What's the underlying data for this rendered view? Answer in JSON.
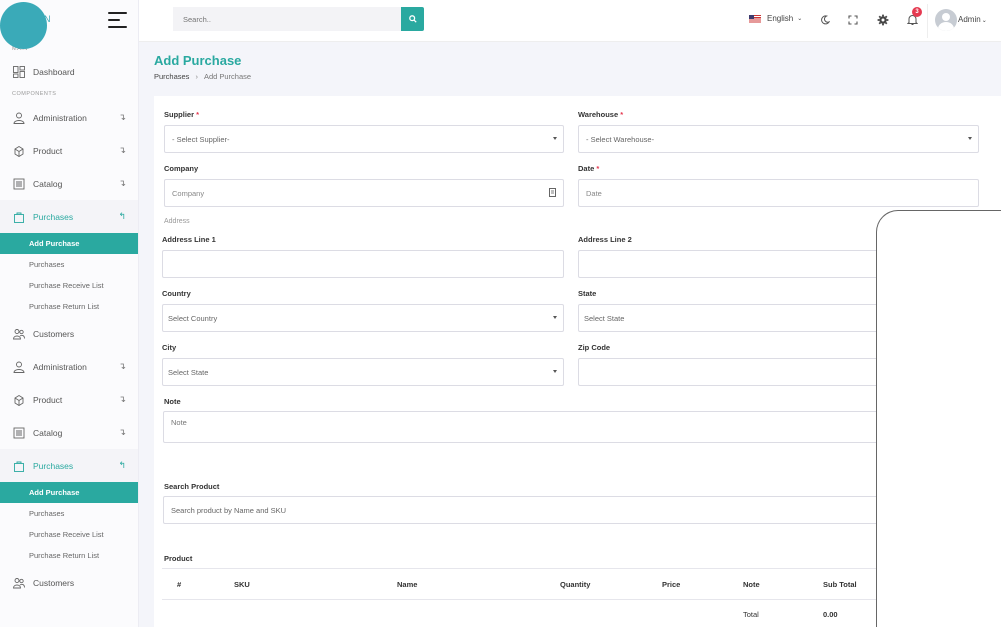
{
  "brand": {
    "logo_text": "N"
  },
  "sidebar": {
    "main_label": "MAIN",
    "components_label": "COMPONENTS",
    "dashboard": "Dashboard",
    "groups": [
      {
        "items": [
          {
            "label": "Administration"
          },
          {
            "label": "Product"
          },
          {
            "label": "Catalog"
          }
        ],
        "purchases": {
          "label": "Purchases",
          "subitems": [
            "Add Purchase",
            "Purchases",
            "Purchase Receive List",
            "Purchase Return List"
          ]
        },
        "customers": "Customers"
      },
      {
        "items": [
          {
            "label": "Administration"
          },
          {
            "label": "Product"
          },
          {
            "label": "Catalog"
          }
        ],
        "purchases": {
          "label": "Purchases",
          "subitems": [
            "Add Purchase",
            "Purchases",
            "Purchase Receive List",
            "Purchase Return List"
          ]
        },
        "customers": "Customers"
      }
    ]
  },
  "topbar": {
    "search_placeholder": "Search..",
    "language": "English",
    "notification_count": "3",
    "user": "Admin"
  },
  "page": {
    "title": "Add Purchase",
    "breadcrumb": [
      "Purchases",
      "Add Purchase"
    ]
  },
  "form": {
    "supplier_label": "Supplier",
    "supplier_value": "- Select Supplier-",
    "warehouse_label": "Warehouse",
    "warehouse_value": "- Select Warehouse-",
    "company_label": "Company",
    "company_placeholder": "Company",
    "date_label": "Date",
    "date_placeholder": "Date",
    "address_section": "Address",
    "address1_label": "Address Line 1",
    "address2_label": "Address Line 2",
    "country_label": "Country",
    "country_value": "Select Country",
    "state_label": "State",
    "state_value": "Select State",
    "city_label": "City",
    "city_value": "Select State",
    "zip_label": "Zip Code",
    "note_label": "Note",
    "note_placeholder": "Note",
    "search_product_label": "Search Product",
    "search_product_placeholder": "Search product by Name and SKU",
    "required_mark": "*"
  },
  "product_table": {
    "title": "Product",
    "columns": [
      "#",
      "SKU",
      "Name",
      "Quantity",
      "Price",
      "Note",
      "Sub Total"
    ],
    "total_label": "Total",
    "total_value": "0.00"
  },
  "colors": {
    "accent": "#2aa9a0",
    "badge": "#e53950"
  }
}
